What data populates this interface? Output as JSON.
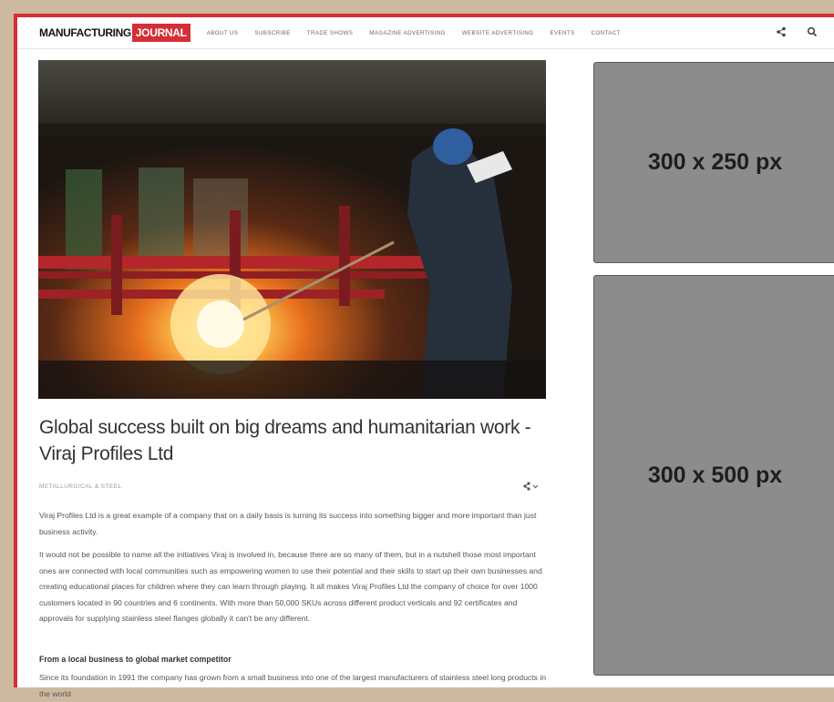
{
  "brand": {
    "logo_part1": "MANUFACTURING",
    "logo_part2": "JOURNAL",
    "accent_color": "#d42e36"
  },
  "nav": {
    "items": [
      {
        "label": "ABOUT US"
      },
      {
        "label": "SUBSCRIBE"
      },
      {
        "label": "TRADE SHOWS"
      },
      {
        "label": "MAGAZINE ADVERTISING"
      },
      {
        "label": "WEBSITE ADVERTISING"
      },
      {
        "label": "EVENTS"
      },
      {
        "label": "CONTACT"
      }
    ],
    "icons": [
      "share-icon",
      "search-icon"
    ]
  },
  "article": {
    "title": "Global success built on big dreams and humanitarian work - Viraj Profiles Ltd",
    "category": "METALLURGICAL & STEEL",
    "share_icon": "share-icon",
    "paragraphs": [
      "Viraj Profiles Ltd is a great example of a company that on a daily basis is turning its success into something bigger and more important than just business activity.",
      "It would not be possible to name all the initiatives Viraj is involved in, because there are so many of them, but in a nutshell those most important ones are connected with local communities such as empowering women to use their potential and their skills to start up their own businesses and creating educational places for children where they can learn through playing. It all makes Viraj Profiles Ltd the company of choice for over 1000 customers located in 90 countries and 6 continents. With more than 50,000 SKUs across different product verticals and 92 certificates and approvals for supplying stainless steel flanges globally it can't be any different."
    ],
    "subheading": "From a local business to global market competitor",
    "paragraph_cut": "Since its foundation in 1991 the company has grown from a small business into one of the largest manufacturers of stainless steel long products in the world"
  },
  "sidebar": {
    "ad1": "300 x 250 px",
    "ad2": "300 x 500 px"
  }
}
